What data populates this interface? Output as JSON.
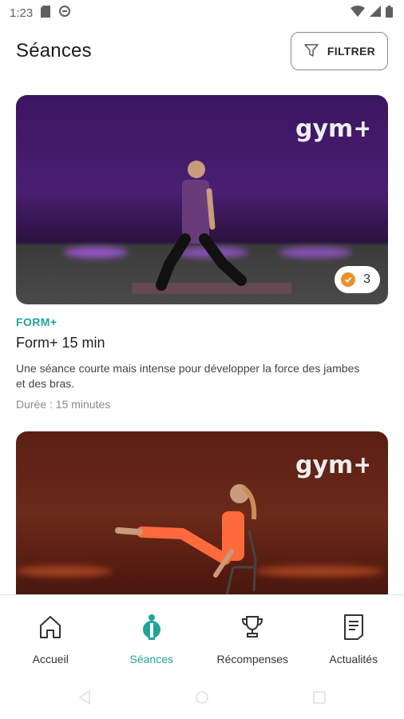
{
  "status_bar": {
    "time": "1:23"
  },
  "header": {
    "title": "Séances",
    "filter_label": "FILTRER"
  },
  "cards": [
    {
      "brand": "gym+",
      "category": "FORM+",
      "title": "Form+ 15 min",
      "description": "Une séance courte mais intense pour développer la force des jambes et des bras.",
      "duration": "Durée : 15 minutes",
      "completed_count": "3"
    },
    {
      "brand": "gym+"
    }
  ],
  "bottom_nav": {
    "items": [
      {
        "label": "Accueil",
        "icon": "home-icon"
      },
      {
        "label": "Séances",
        "icon": "person-icon"
      },
      {
        "label": "Récompenses",
        "icon": "trophy-icon"
      },
      {
        "label": "Actualités",
        "icon": "document-icon"
      }
    ],
    "active_index": 1
  },
  "colors": {
    "accent": "#1fa39a",
    "badge_check": "#e8912c"
  }
}
